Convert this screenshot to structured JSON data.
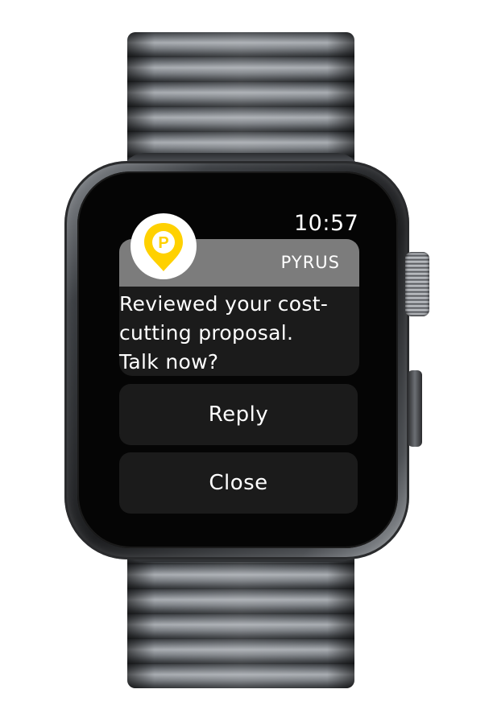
{
  "status_bar": {
    "time": "10:57"
  },
  "notification": {
    "app_name": "PYRUS",
    "app_icon": "pyrus-logo-icon",
    "accent_color": "#ffd100",
    "message": "Reviewed your cost-\ncutting proposal.\nTalk now?"
  },
  "actions": {
    "reply_label": "Reply",
    "close_label": "Close"
  },
  "device": {
    "crown": "digital-crown",
    "side_button": "side-button"
  }
}
